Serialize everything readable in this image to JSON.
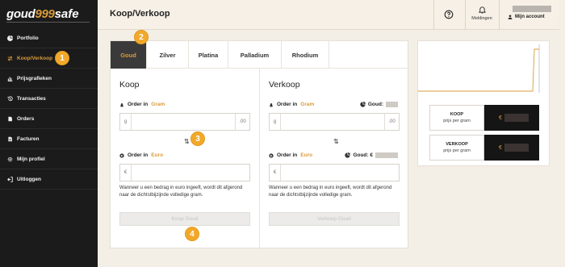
{
  "logo": {
    "part1": "goud",
    "part2": "999",
    "part3": "safe"
  },
  "sidebar": {
    "items": [
      {
        "label": "Portfolio",
        "icon": "pie-chart-icon",
        "active": false
      },
      {
        "label": "Koop/Verkoop",
        "icon": "swap-icon",
        "active": true
      },
      {
        "label": "Prijsgrafieken",
        "icon": "bar-chart-icon",
        "active": false
      },
      {
        "label": "Transacties",
        "icon": "history-icon",
        "active": false
      },
      {
        "label": "Orders",
        "icon": "document-icon",
        "active": false
      },
      {
        "label": "Facturen",
        "icon": "invoice-icon",
        "active": false
      },
      {
        "label": "Mijn profiel",
        "icon": "gear-icon",
        "active": false
      },
      {
        "label": "Uitloggen",
        "icon": "logout-icon",
        "active": false
      }
    ]
  },
  "header": {
    "title": "Koop/Verkoop",
    "notifications_label": "Meldingen",
    "account_label": "Mijn account"
  },
  "metal_tabs": [
    "Goud",
    "Zilver",
    "Platina",
    "Palladium",
    "Rhodium"
  ],
  "buy": {
    "title": "Koop",
    "order_gram_label": "Order in",
    "gram_unit": "Gram",
    "gram_prefix": "g",
    "gram_suffix": ".00",
    "order_euro_label": "Order in",
    "euro_unit": "Euro",
    "euro_prefix": "€",
    "note": "Wanneer u een bedrag in euro ingeeft, wordt dit afgerond naar de dichtstbijzijnde volledige gram.",
    "button": "Koop Goud"
  },
  "sell": {
    "title": "Verkoop",
    "order_gram_label": "Order in",
    "gram_unit": "Gram",
    "gram_prefix": "g",
    "gram_suffix": ".00",
    "gold_label": "Goud:",
    "gold_euro_label": "Goud: €",
    "order_euro_label": "Order in",
    "euro_unit": "Euro",
    "euro_prefix": "€",
    "note": "Wanneer u een bedrag in euro ingeeft, wordt dit afgerond naar de dichtstbijzijnde volledige gram.",
    "button": "Verkoop Goud"
  },
  "prices": {
    "buy_title": "KOOP",
    "buy_sub": "prijs per gram",
    "sell_title": "VERKOOP",
    "sell_sub": "prijs per gram",
    "currency": "€"
  },
  "badges": [
    "1",
    "2",
    "3",
    "4"
  ],
  "colors": {
    "accent": "#d99b3c",
    "sidebar": "#1b1b1b",
    "badge": "#f2a82b",
    "background": "#f3eee6"
  }
}
